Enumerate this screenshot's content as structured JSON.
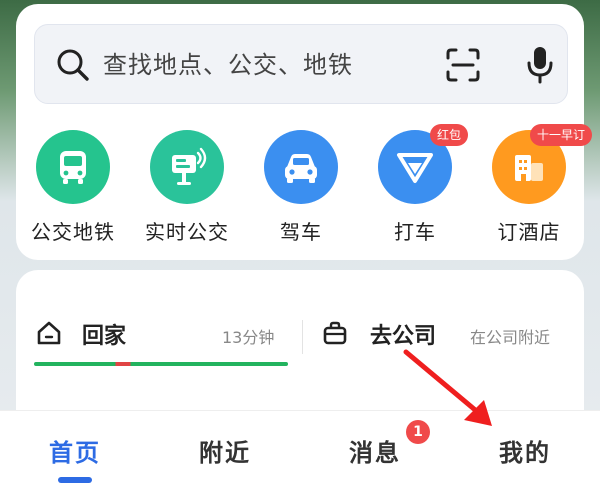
{
  "search": {
    "placeholder": "查找地点、公交、地铁",
    "search_icon": "search-icon",
    "scan_icon": "scan-icon",
    "mic_icon": "microphone-icon"
  },
  "quick_actions": [
    {
      "label": "公交地铁",
      "icon": "bus-icon",
      "color": "#25c48e",
      "badge": ""
    },
    {
      "label": "实时公交",
      "icon": "bus-stop-screen-icon",
      "color": "#2ac39a",
      "badge": ""
    },
    {
      "label": "驾车",
      "icon": "car-icon",
      "color": "#3b8ff0",
      "badge": ""
    },
    {
      "label": "打车",
      "icon": "taxi-icon",
      "color": "#3b8ff0",
      "badge": "红包"
    },
    {
      "label": "订酒店",
      "icon": "hotel-icon",
      "color": "#ff9a1f",
      "badge": "十一早订"
    }
  ],
  "commute": {
    "home_label": "回家",
    "home_time": "13分钟",
    "company_label": "去公司",
    "company_hint": "在公司附近"
  },
  "nav": {
    "items": [
      "首页",
      "附近",
      "消息",
      "我的"
    ],
    "active_index": 0,
    "message_badge": "1"
  },
  "colors": {
    "accent": "#2d6be4",
    "badge": "#f04a4a",
    "route_green": "#22b35e",
    "route_red": "#e04444"
  }
}
